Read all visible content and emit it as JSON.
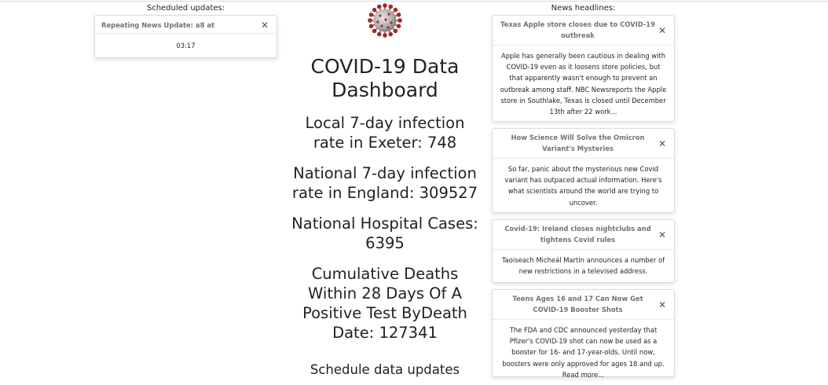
{
  "scheduled": {
    "heading": "Scheduled updates:",
    "items": [
      {
        "title": "Repeating News Update: a8 at",
        "time": "03:17"
      }
    ]
  },
  "dashboard": {
    "title": "COVID-19 Data Dashboard",
    "local_rate": "Local 7-day infection rate in Exeter: 748",
    "national_rate": "National 7-day infection rate in England: 309527",
    "hospital_cases": "National Hospital Cases: 6395",
    "deaths": "Cumulative Deaths Within 28 Days Of A Positive Test ByDeath Date: 127341",
    "schedule_heading": "Schedule data updates"
  },
  "news": {
    "heading": "News headlines:",
    "items": [
      {
        "title": "Texas Apple store closes due to COVID-19 outbreak",
        "body": "Apple has generally been cautious in dealing with COVID-19 even as it loosens store policies, but that apparently wasn't enough to prevent an outbreak among staff. NBC Newsreports the Apple store in Southlake, Texas is closed until December 13th after 22 work..."
      },
      {
        "title": "How Science Will Solve the Omicron Variant's Mysteries",
        "body": "So far, panic about the mysterious new Covid variant has outpaced actual information. Here's what scientists around the world are trying to uncover."
      },
      {
        "title": "Covid-19: Ireland closes nightclubs and tightens Covid rules",
        "body": "Taoiseach Micheál Martin announces a number of new restrictions in a televised address."
      },
      {
        "title": "Teens Ages 16 and 17 Can Now Get COVID-19 Booster Shots",
        "body": "The FDA and CDC announced yesterday that Pfizer's COVID-19 shot can now be used as a booster for 16- and 17-year-olds. Until now, boosters were only approved for ages 18 and up. Read more..."
      }
    ]
  },
  "icons": {
    "logo": "coronavirus-icon",
    "close": "close-icon"
  },
  "colors": {
    "virus": "#b22a2a",
    "toast_header_text": "#6c757d"
  }
}
